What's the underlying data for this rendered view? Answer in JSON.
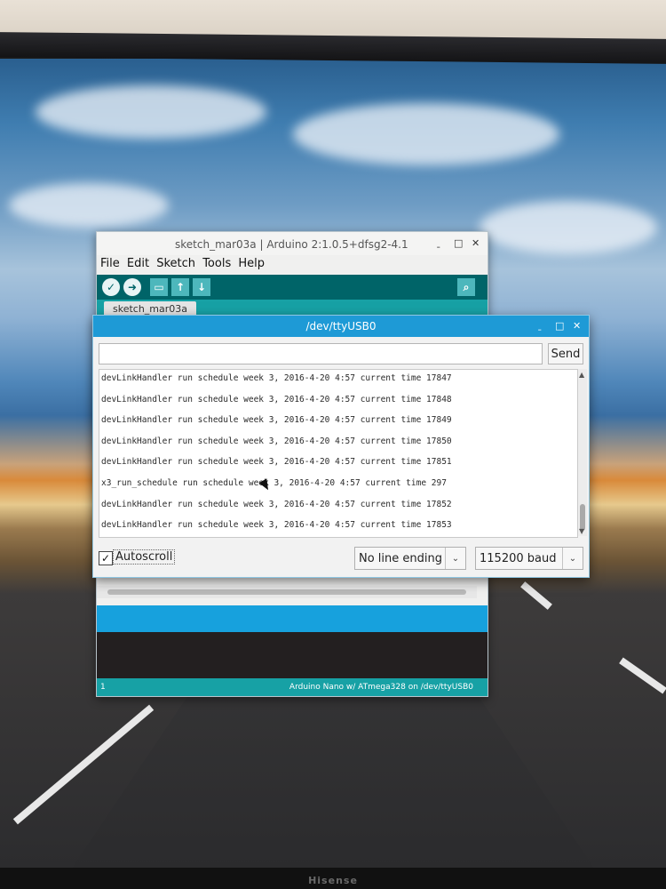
{
  "monitor": {
    "brand": "Hisense"
  },
  "ide": {
    "title": "sketch_mar03a | Arduino 2:1.0.5+dfsg2-4.1",
    "window_controls": [
      "ˍ",
      "□",
      "✕"
    ],
    "menu": [
      "File",
      "Edit",
      "Sketch",
      "Tools",
      "Help"
    ],
    "tab": "sketch_mar03a",
    "status": {
      "line": "1",
      "board": "Arduino Nano w/ ATmega328 on /dev/ttyUSB0"
    }
  },
  "serial": {
    "title": "/dev/ttyUSB0",
    "window_controls": [
      "ˍ",
      "□",
      "✕"
    ],
    "input_value": "",
    "send_label": "Send",
    "lines": [
      "devLinkHandler run schedule week 3, 2016-4-20 4:57 current time 17847",
      "devLinkHandler run schedule week 3, 2016-4-20 4:57 current time 17848",
      "devLinkHandler run schedule week 3, 2016-4-20 4:57 current time 17849",
      "devLinkHandler run schedule week 3, 2016-4-20 4:57 current time 17850",
      "devLinkHandler run schedule week 3, 2016-4-20 4:57 current time 17851",
      "x3_run_schedule run schedule week 3, 2016-4-20 4:57 current time 297",
      "devLinkHandler run schedule week 3, 2016-4-20 4:57 current time 17852",
      "devLinkHandler run schedule week 3, 2016-4-20 4:57 current time 17853"
    ],
    "autoscroll": {
      "label": "Autoscroll",
      "checked": true
    },
    "line_ending": "No line ending",
    "baud_rate": "115200 baud"
  },
  "colors": {
    "ide_toolbar": "#006468",
    "ide_tabbar": "#17a1a5",
    "serial_titlebar": "#1e9ad6",
    "console_bg": "#231f20"
  },
  "icons": [
    "verify-icon",
    "upload-icon",
    "new-icon",
    "open-icon",
    "save-icon",
    "serial-monitor-icon",
    "chevron-down-icon",
    "checkmark-icon"
  ]
}
